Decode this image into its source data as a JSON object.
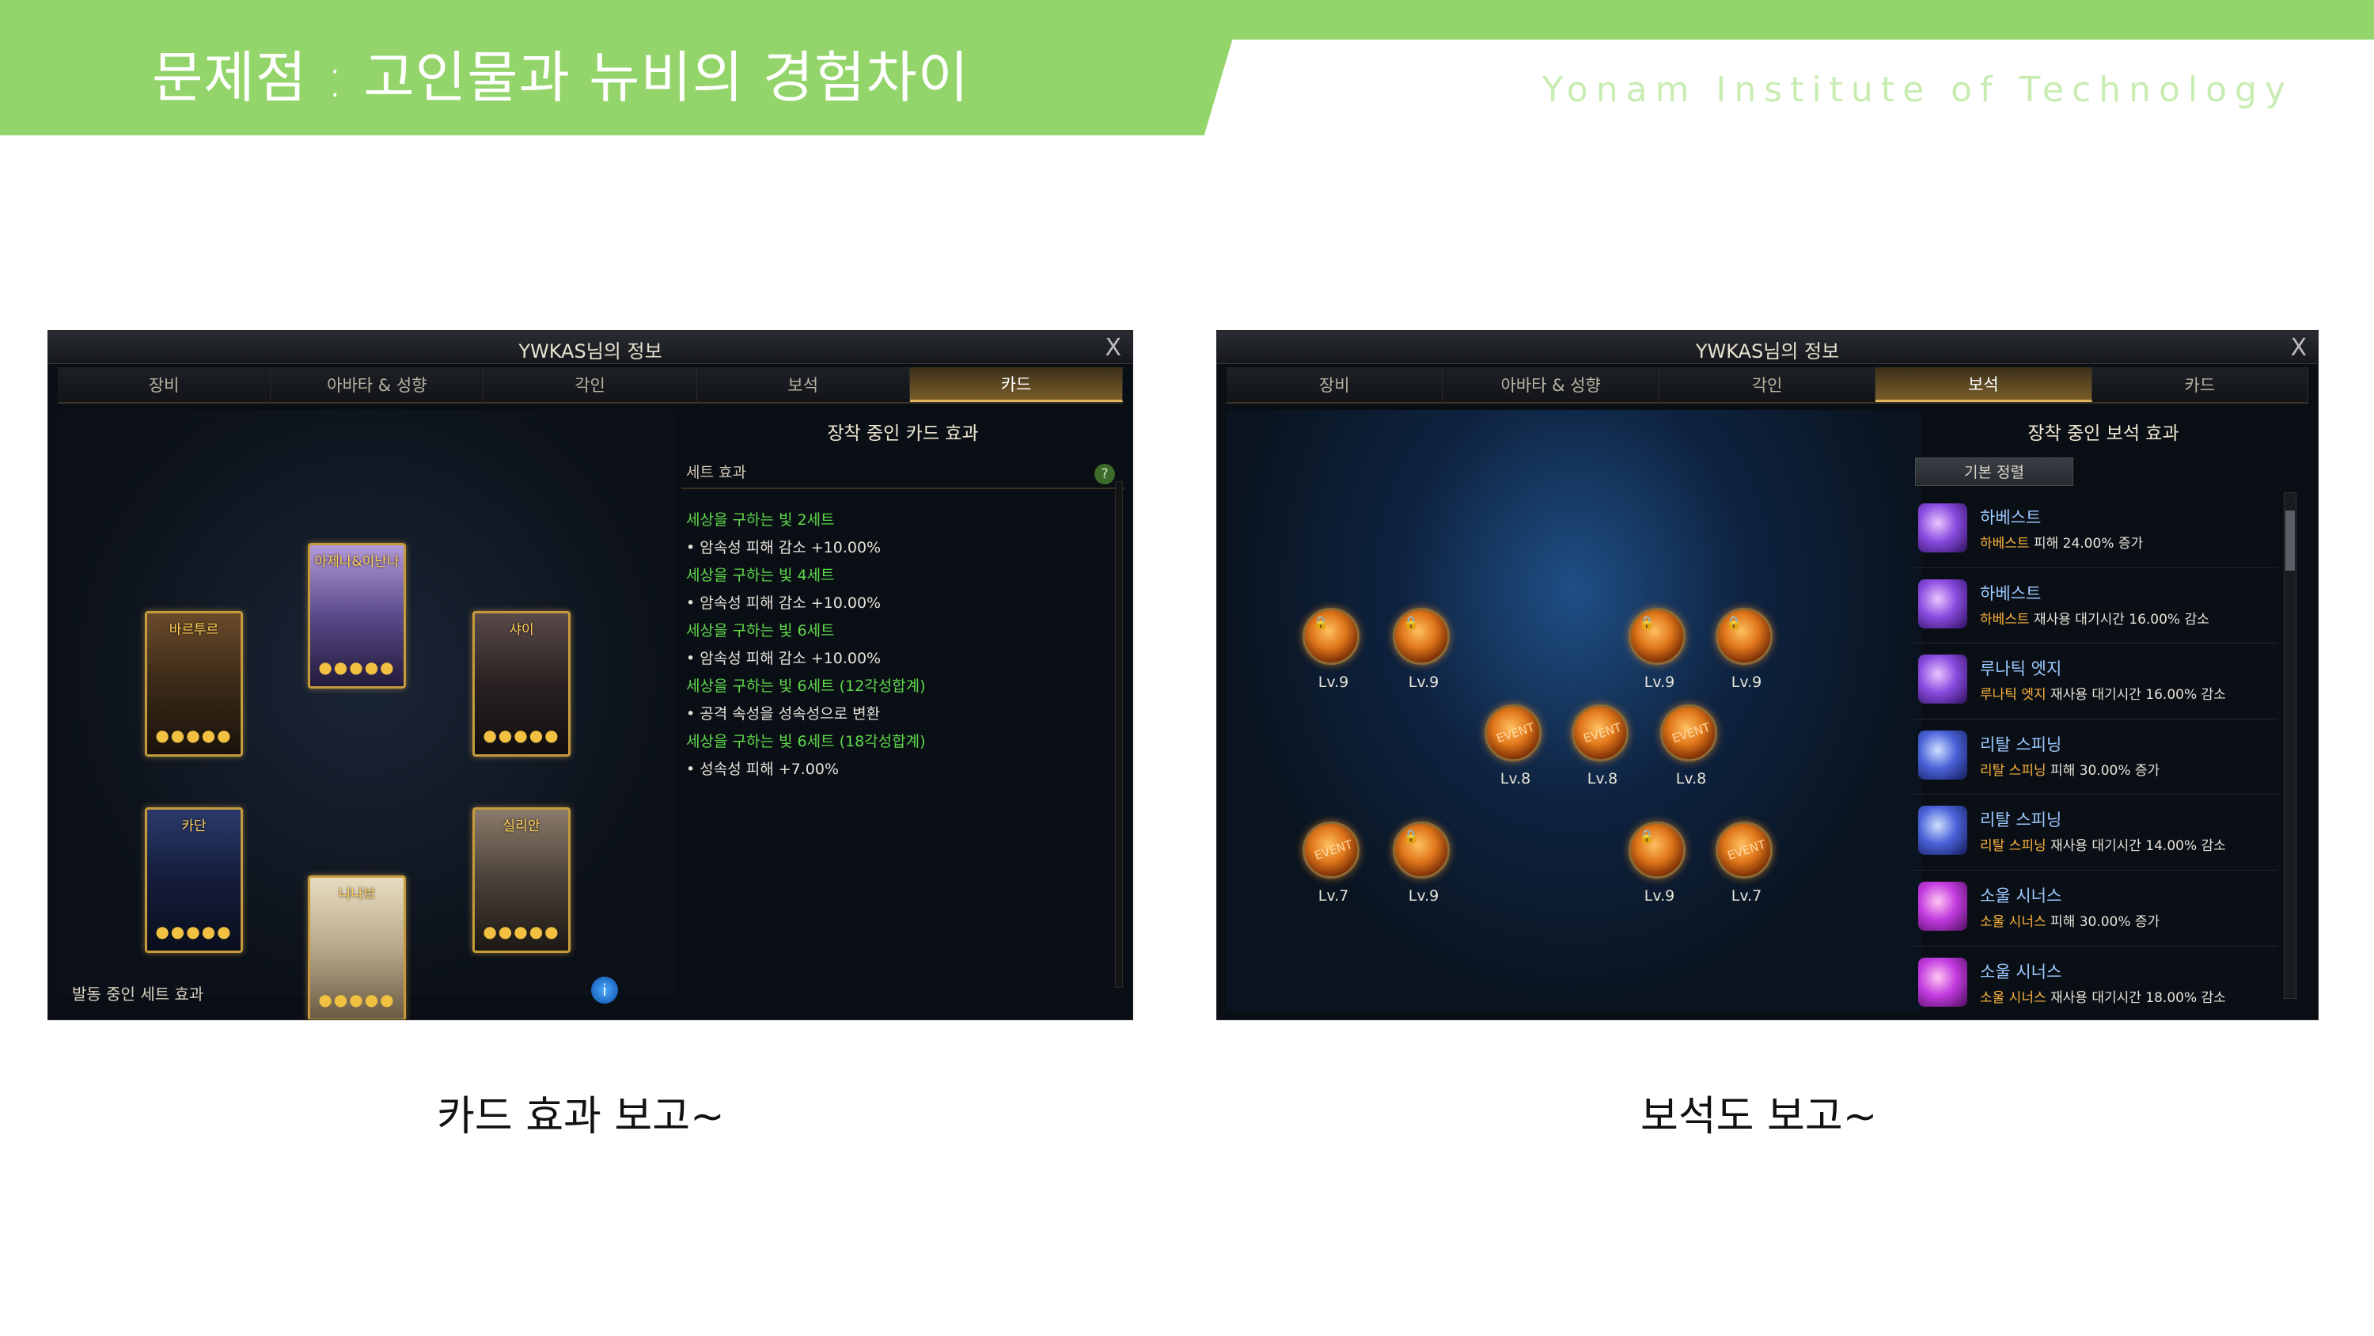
{
  "slide": {
    "title": "문제점 : 고인물과 뉴비의 경험차이",
    "institute": "Yonam Institute of Technology",
    "captions": [
      "카드 효과 보고~",
      "보석도 보고~"
    ],
    "accent_color": "#93d46b"
  },
  "card_window": {
    "title": "YWKAS님의 정보",
    "close_label": "X",
    "tabs": [
      "장비",
      "아바타 & 성향",
      "각인",
      "보석",
      "카드"
    ],
    "active_tab": "카드",
    "panel_title": "장착 중인 카드 효과",
    "panel_sub": "세트 효과",
    "help_label": "?",
    "set_effects": [
      {
        "text": "세상을 구하는 빛 2세트",
        "style": "green"
      },
      {
        "text": "• 암속성 피해 감소 +10.00%",
        "style": "white"
      },
      {
        "text": "세상을 구하는 빛 4세트",
        "style": "green"
      },
      {
        "text": "• 암속성 피해 감소 +10.00%",
        "style": "white"
      },
      {
        "text": "세상을 구하는 빛 6세트",
        "style": "green"
      },
      {
        "text": "• 암속성 피해 감소 +10.00%",
        "style": "white"
      },
      {
        "text": "세상을 구하는 빛 6세트 (12각성합계)",
        "style": "green"
      },
      {
        "text": "• 공격 속성을 성속성으로 변환",
        "style": "white"
      },
      {
        "text": "세상을 구하는 빛 6세트 (18각성합계)",
        "style": "green"
      },
      {
        "text": "• 성속성 피해 +7.00%",
        "style": "white"
      }
    ],
    "cards": [
      {
        "name": "바르투르",
        "gems": "●●●●●"
      },
      {
        "name": "아제나&이난나",
        "gems": "●●●●●"
      },
      {
        "name": "샤이",
        "gems": "●●●●●"
      },
      {
        "name": "카단",
        "gems": "●●●●●"
      },
      {
        "name": "니나브",
        "gems": "●●●●●"
      },
      {
        "name": "실리안",
        "gems": "●●●●●"
      }
    ],
    "footer_label": "발동 중인 세트 효과",
    "info_label": "i"
  },
  "gem_window": {
    "title": "YWKAS님의 정보",
    "close_label": "X",
    "tabs": [
      "장비",
      "아바타 & 성향",
      "각인",
      "보석",
      "카드"
    ],
    "active_tab": "보석",
    "panel_title": "장착 중인 보석 효과",
    "sort_label": "기본 정렬",
    "gems": [
      {
        "level": "Lv.9",
        "tag": "",
        "locked": true
      },
      {
        "level": "Lv.9",
        "tag": "",
        "locked": true
      },
      {
        "level": "Lv.9",
        "tag": "",
        "locked": true
      },
      {
        "level": "Lv.9",
        "tag": "",
        "locked": true
      },
      {
        "level": "Lv.8",
        "tag": "EVENT",
        "locked": false
      },
      {
        "level": "Lv.8",
        "tag": "EVENT",
        "locked": false
      },
      {
        "level": "Lv.8",
        "tag": "EVENT",
        "locked": false
      },
      {
        "level": "Lv.7",
        "tag": "EVENT",
        "locked": false
      },
      {
        "level": "Lv.9",
        "tag": "",
        "locked": true
      },
      {
        "level": "Lv.9",
        "tag": "",
        "locked": true
      },
      {
        "level": "Lv.7",
        "tag": "EVENT",
        "locked": false
      }
    ],
    "lock_symbol": "🔒",
    "effects": [
      {
        "name": "하베스트",
        "skill": "하베스트",
        "desc": " 피해 24.00% 증가",
        "icon": "purple"
      },
      {
        "name": "하베스트",
        "skill": "하베스트",
        "desc": " 재사용 대기시간 16.00% 감소",
        "icon": "purple"
      },
      {
        "name": "루나틱 엣지",
        "skill": "루나틱 엣지",
        "desc": " 재사용 대기시간 16.00% 감소",
        "icon": "purple"
      },
      {
        "name": "리탈 스피닝",
        "skill": "리탈 스피닝",
        "desc": " 피해 30.00% 증가",
        "icon": "blue"
      },
      {
        "name": "리탈 스피닝",
        "skill": "리탈 스피닝",
        "desc": " 재사용 대기시간 14.00% 감소",
        "icon": "blue"
      },
      {
        "name": "소울 시너스",
        "skill": "소울 시너스",
        "desc": " 피해 30.00% 증가",
        "icon": "pink"
      },
      {
        "name": "소울 시너스",
        "skill": "소울 시너스",
        "desc": " 재사용 대기시간 18.00% 감소",
        "icon": "pink"
      }
    ]
  }
}
